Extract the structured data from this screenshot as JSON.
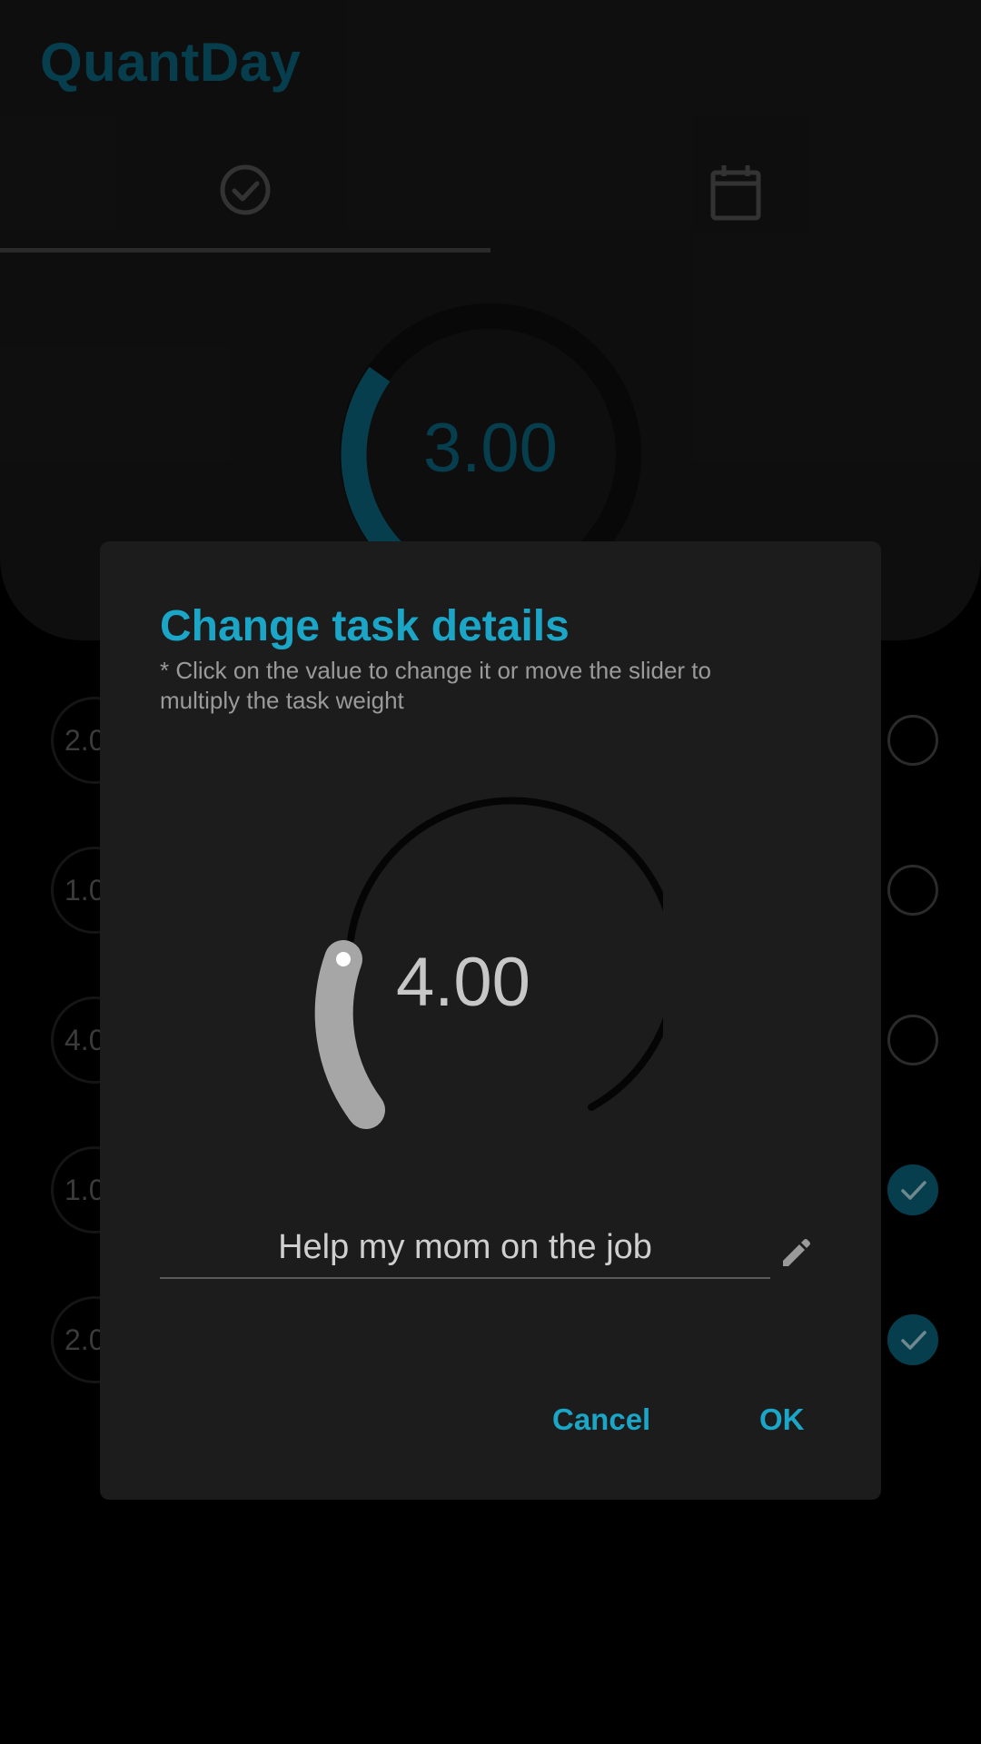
{
  "app": {
    "title": "QuantDay",
    "progress_value": "3.00"
  },
  "tabs": [
    {
      "icon": "check-circle-icon",
      "selected": true
    },
    {
      "icon": "calendar-icon",
      "selected": false
    }
  ],
  "tasks": [
    {
      "weight": "2.00",
      "done": false
    },
    {
      "weight": "1.00",
      "done": false
    },
    {
      "weight": "4.00",
      "done": false
    },
    {
      "weight": "1.00",
      "done": true
    },
    {
      "weight": "2.00",
      "done": true
    }
  ],
  "dialog": {
    "title": "Change task details",
    "hint": "* Click on the value to change it or move the slider to multiply the task weight",
    "dial_value": "4.00",
    "task_name": "Help my mom on the job",
    "cancel_label": "Cancel",
    "ok_label": "OK"
  },
  "colors": {
    "accent": "#1ba5c6",
    "accent_dim": "#0a5a70",
    "background": "#000000",
    "dialog_bg": "#1c1c1c"
  }
}
